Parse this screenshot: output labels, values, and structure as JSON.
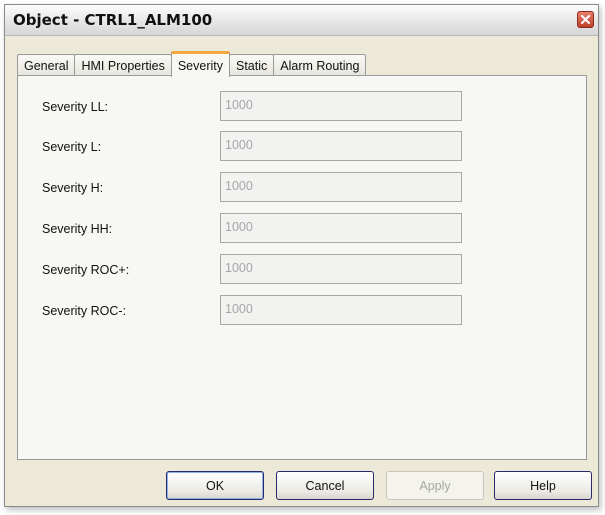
{
  "window": {
    "title": "Object - CTRL1_ALM100"
  },
  "tabs": [
    {
      "label": "General"
    },
    {
      "label": "HMI Properties"
    },
    {
      "label": "Severity",
      "active": true
    },
    {
      "label": "Static"
    },
    {
      "label": "Alarm Routing"
    }
  ],
  "fields": [
    {
      "label": "Severity LL:",
      "value": "1000"
    },
    {
      "label": "Severity L:",
      "value": "1000"
    },
    {
      "label": "Severity H:",
      "value": "1000"
    },
    {
      "label": "Severity HH:",
      "value": "1000"
    },
    {
      "label": "Severity ROC+:",
      "value": "1000"
    },
    {
      "label": "Severity ROC-:",
      "value": "1000"
    }
  ],
  "buttons": {
    "ok": "OK",
    "cancel": "Cancel",
    "apply": "Apply",
    "help": "Help"
  }
}
